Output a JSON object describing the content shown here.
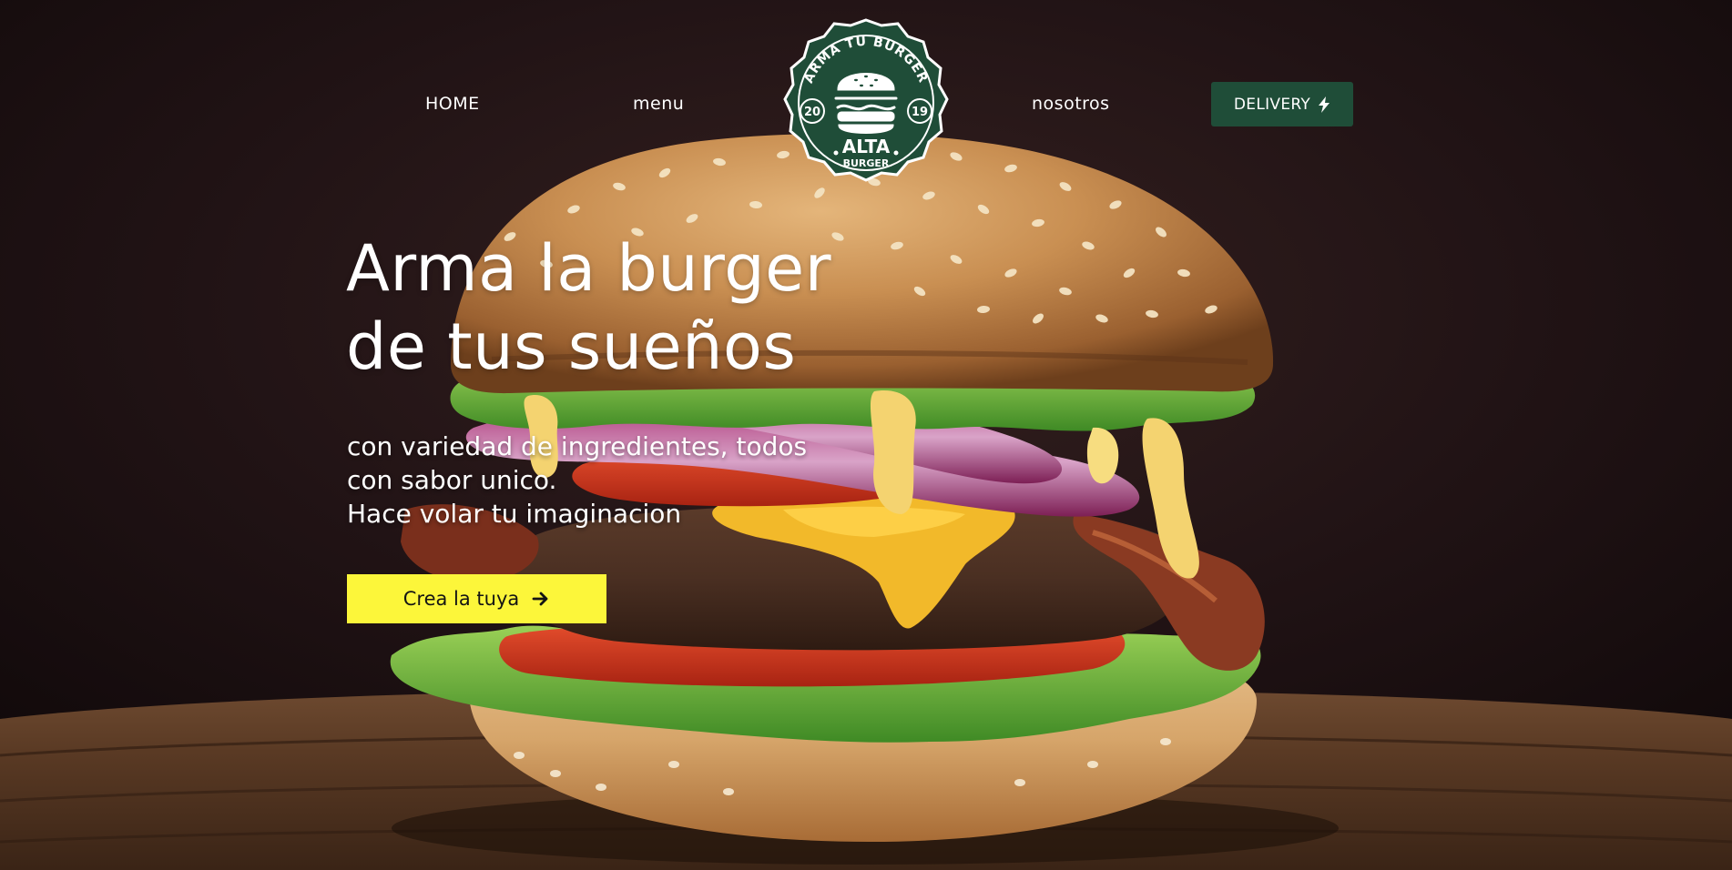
{
  "nav": {
    "home": "HOME",
    "menu": "menu",
    "nosotros": "nosotros",
    "delivery": "DELIVERY",
    "delivery_icon": "lightning-bolt-icon"
  },
  "logo": {
    "top_text": "ARMA TU BURGER",
    "year_left": "20",
    "year_right": "19",
    "name": "ALTA",
    "subname": "BURGER",
    "color": "#1f4d38"
  },
  "hero": {
    "title_lines": [
      "Arma la burger",
      "de tus sueños"
    ],
    "subtitle_lines": [
      "con variedad de ingredientes, todos",
      "con sabor unico.",
      "Hace volar tu imaginacion"
    ],
    "cta_label": "Crea la tuya",
    "cta_icon": "arrow-right-icon",
    "cta_color": "#fcf63a"
  },
  "colors": {
    "background": "#1c1012",
    "brand_green": "#1f4d38",
    "accent_yellow": "#fcf63a"
  }
}
